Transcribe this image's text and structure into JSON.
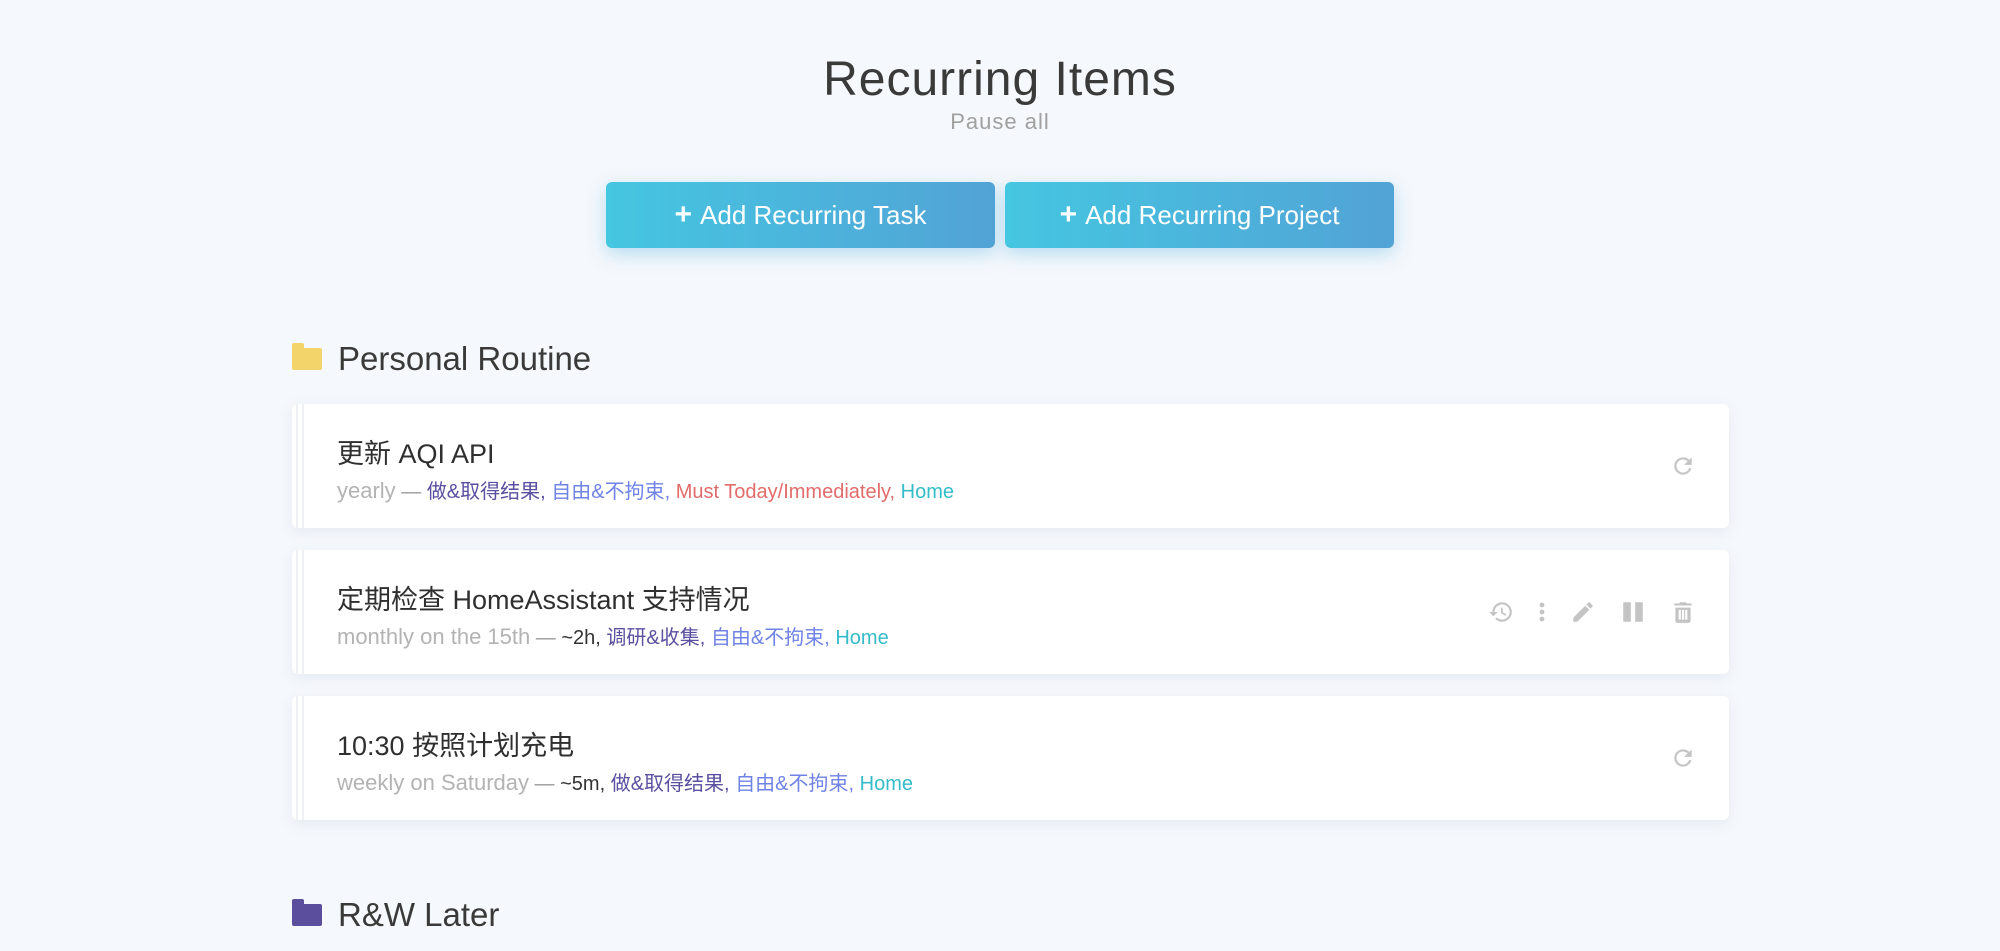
{
  "header": {
    "title": "Recurring Items",
    "pause_all": "Pause all"
  },
  "buttons": {
    "add_task": "Add Recurring Task",
    "add_project": "Add Recurring Project"
  },
  "sections": [
    {
      "name": "Personal Routine",
      "folder_color": "#f2d46b",
      "items": [
        {
          "title": "更新 AQI API",
          "frequency": "yearly",
          "dash": " — ",
          "duration": "",
          "tags": [
            "做&取得结果,",
            "自由&不拘束,",
            "Must Today/Immediately,",
            "Home"
          ]
        },
        {
          "title": "定期检查 HomeAssistant 支持情况",
          "frequency": "monthly on the 15th",
          "dash": " — ",
          "duration": "~2h,",
          "tags": [
            "调研&收集,",
            "自由&不拘束,",
            "Home"
          ]
        },
        {
          "title": "10:30 按照计划充电",
          "frequency": "weekly on Saturday",
          "dash": " — ",
          "duration": "~5m,",
          "tags": [
            "做&取得结果,",
            "自由&不拘束,",
            "Home"
          ]
        }
      ]
    },
    {
      "name": "R&W Later",
      "folder_color": "#5b4e9c"
    }
  ],
  "icons": {
    "refresh": "refresh-icon",
    "history": "history-icon",
    "more": "more-vertical-icon",
    "edit": "pencil-icon",
    "pause": "pause-icon",
    "delete": "trash-icon"
  }
}
